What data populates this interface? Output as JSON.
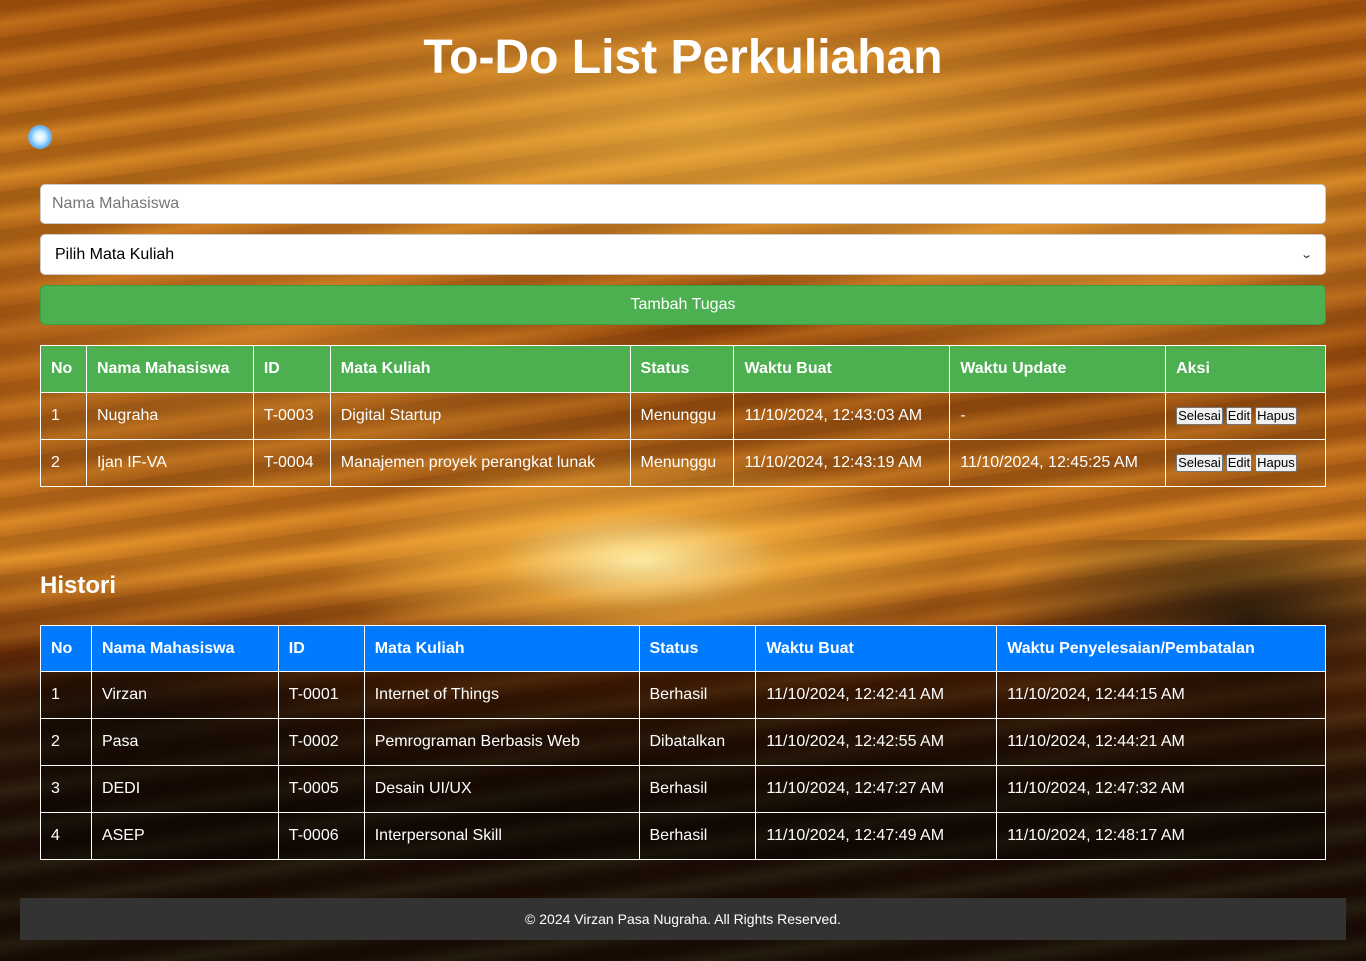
{
  "page": {
    "title": "To-Do List Perkuliahan"
  },
  "form": {
    "name_placeholder": "Nama Mahasiswa",
    "course_selected": "Pilih Mata Kuliah",
    "add_button": "Tambah Tugas"
  },
  "tasks": {
    "headers": [
      "No",
      "Nama Mahasiswa",
      "ID",
      "Mata Kuliah",
      "Status",
      "Waktu Buat",
      "Waktu Update",
      "Aksi"
    ],
    "rows": [
      {
        "no": "1",
        "name": "Nugraha",
        "id": "T-0003",
        "course": "Digital Startup",
        "status": "Menunggu",
        "created": "11/10/2024, 12:43:03 AM",
        "updated": "-"
      },
      {
        "no": "2",
        "name": "Ijan IF-VA",
        "id": "T-0004",
        "course": "Manajemen proyek perangkat lunak",
        "status": "Menunggu",
        "created": "11/10/2024, 12:43:19 AM",
        "updated": "11/10/2024, 12:45:25 AM"
      }
    ],
    "actions": {
      "done": "Selesai",
      "edit": "Edit",
      "delete": "Hapus"
    }
  },
  "history": {
    "title": "Histori",
    "headers": [
      "No",
      "Nama Mahasiswa",
      "ID",
      "Mata Kuliah",
      "Status",
      "Waktu Buat",
      "Waktu Penyelesaian/Pembatalan"
    ],
    "rows": [
      {
        "no": "1",
        "name": "Virzan",
        "id": "T-0001",
        "course": "Internet of Things",
        "status": "Berhasil",
        "created": "11/10/2024, 12:42:41 AM",
        "finished": "11/10/2024, 12:44:15 AM"
      },
      {
        "no": "2",
        "name": "Pasa",
        "id": "T-0002",
        "course": "Pemrograman Berbasis Web",
        "status": "Dibatalkan",
        "created": "11/10/2024, 12:42:55 AM",
        "finished": "11/10/2024, 12:44:21 AM"
      },
      {
        "no": "3",
        "name": "DEDI",
        "id": "T-0005",
        "course": "Desain UI/UX",
        "status": "Berhasil",
        "created": "11/10/2024, 12:47:27 AM",
        "finished": "11/10/2024, 12:47:32 AM"
      },
      {
        "no": "4",
        "name": "ASEP",
        "id": "T-0006",
        "course": "Interpersonal Skill",
        "status": "Berhasil",
        "created": "11/10/2024, 12:47:49 AM",
        "finished": "11/10/2024, 12:48:17 AM"
      }
    ]
  },
  "footer": {
    "text": "© 2024 Virzan Pasa Nugraha. All Rights Reserved."
  },
  "colors": {
    "green": "#4caf50",
    "blue": "#007bff",
    "footer_bg": "#333333"
  },
  "icons": {
    "select_arrow": "chevron-down-icon",
    "orb": "glow-orb-icon"
  }
}
